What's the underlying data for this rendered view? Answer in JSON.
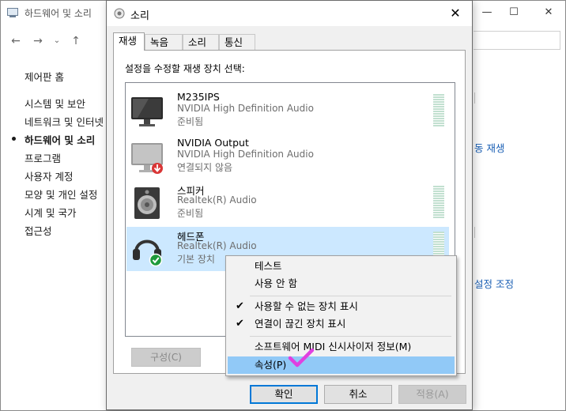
{
  "background_window": {
    "title": "하드웨어 및 소리",
    "sidebar": [
      {
        "label": "제어판 홈",
        "active": false
      },
      {
        "label": "시스템 및 보안",
        "active": false
      },
      {
        "label": "네트워크 및 인터넷",
        "active": false
      },
      {
        "label": "하드웨어 및 소리",
        "active": true
      },
      {
        "label": "프로그램",
        "active": false
      },
      {
        "label": "사용자 계정",
        "active": false
      },
      {
        "label": "모양 및 개인 설정",
        "active": false
      },
      {
        "label": "시계 및 국가",
        "active": false
      },
      {
        "label": "접근성",
        "active": false
      }
    ],
    "links": [
      "동 재생",
      "설정 조정"
    ]
  },
  "dialog": {
    "title": "소리",
    "tabs": [
      "재생",
      "녹음",
      "소리",
      "통신"
    ],
    "instruction": "설정을 수정할 재생 장치 선택:",
    "devices": [
      {
        "name": "M235IPS",
        "driver": "NVIDIA High Definition Audio",
        "state": "준비됨",
        "icon": "monitor-icon"
      },
      {
        "name": "NVIDIA Output",
        "driver": "NVIDIA High Definition Audio",
        "state": "연결되지 않음",
        "icon": "monitor-disconnected-icon"
      },
      {
        "name": "스피커",
        "driver": "Realtek(R) Audio",
        "state": "준비됨",
        "icon": "speaker-icon"
      },
      {
        "name": "헤드폰",
        "driver": "Realtek(R) Audio",
        "state": "기본 장치",
        "icon": "headphones-default-icon"
      }
    ],
    "config_button": "구성(C)",
    "ok_button": "확인",
    "cancel_button": "취소",
    "apply_button": "적용(A)"
  },
  "context_menu": {
    "items": [
      {
        "label": "테스트",
        "checked": false
      },
      {
        "label": "사용 안 함",
        "checked": false
      },
      {
        "label": "사용할 수 없는 장치 표시",
        "checked": true
      },
      {
        "label": "연결이 끊긴 장치 표시",
        "checked": true
      },
      {
        "label": "소프트웨어 MIDI 신시사이저 정보(M)",
        "checked": false
      },
      {
        "label": "속성(P)",
        "checked": false,
        "highlighted": true
      }
    ],
    "check_glyph": "✔"
  },
  "colors": {
    "selection": "#cce8ff",
    "menu_highlight": "#91c9f7",
    "annotation": "#e040e0",
    "ok_border": "#0078d7"
  }
}
